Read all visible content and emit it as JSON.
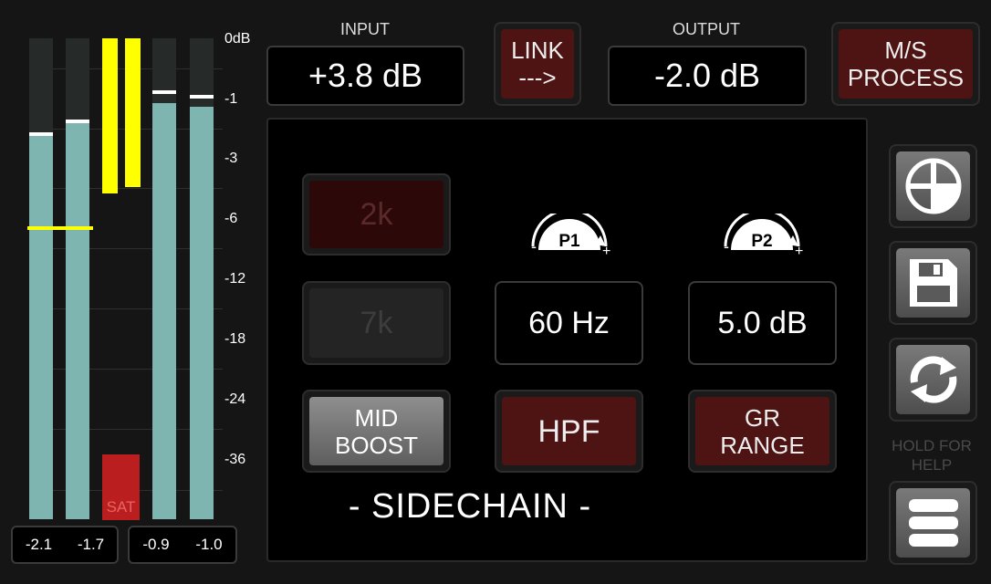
{
  "meters": {
    "scale": [
      "0dB",
      "-1",
      "-3",
      "-6",
      "-12",
      "-18",
      "-24",
      "-36"
    ],
    "left_readouts": [
      "-2.1",
      "-1.7"
    ],
    "right_readouts": [
      "-0.9",
      "-1.0"
    ],
    "sat_label": "SAT",
    "colors": {
      "level": "#7fb5b0",
      "gain_reduction": "#ffff00",
      "sat": "#bb1e1e"
    }
  },
  "input": {
    "label": "INPUT",
    "value": "+3.8 dB"
  },
  "link": {
    "line1": "LINK",
    "line2": "--->"
  },
  "output": {
    "label": "OUTPUT",
    "value": "-2.0 dB"
  },
  "ms_process": {
    "line1": "M/S",
    "line2": "PROCESS"
  },
  "sidechain": {
    "btn_2k": "2k",
    "btn_7k": "7k",
    "mid_boost": {
      "line1": "MID",
      "line2": "BOOST"
    },
    "p1": {
      "label": "P1",
      "value": "60 Hz"
    },
    "p2": {
      "label": "P2",
      "value": "5.0 dB"
    },
    "hpf": "HPF",
    "gr_range": {
      "line1": "GR",
      "line2": "RANGE"
    },
    "title": "- SIDECHAIN -"
  },
  "side": {
    "help_line1": "HOLD FOR",
    "help_line2": "HELP",
    "icons": [
      "quadrant-icon",
      "save-icon",
      "refresh-icon",
      "menu-icon"
    ]
  }
}
